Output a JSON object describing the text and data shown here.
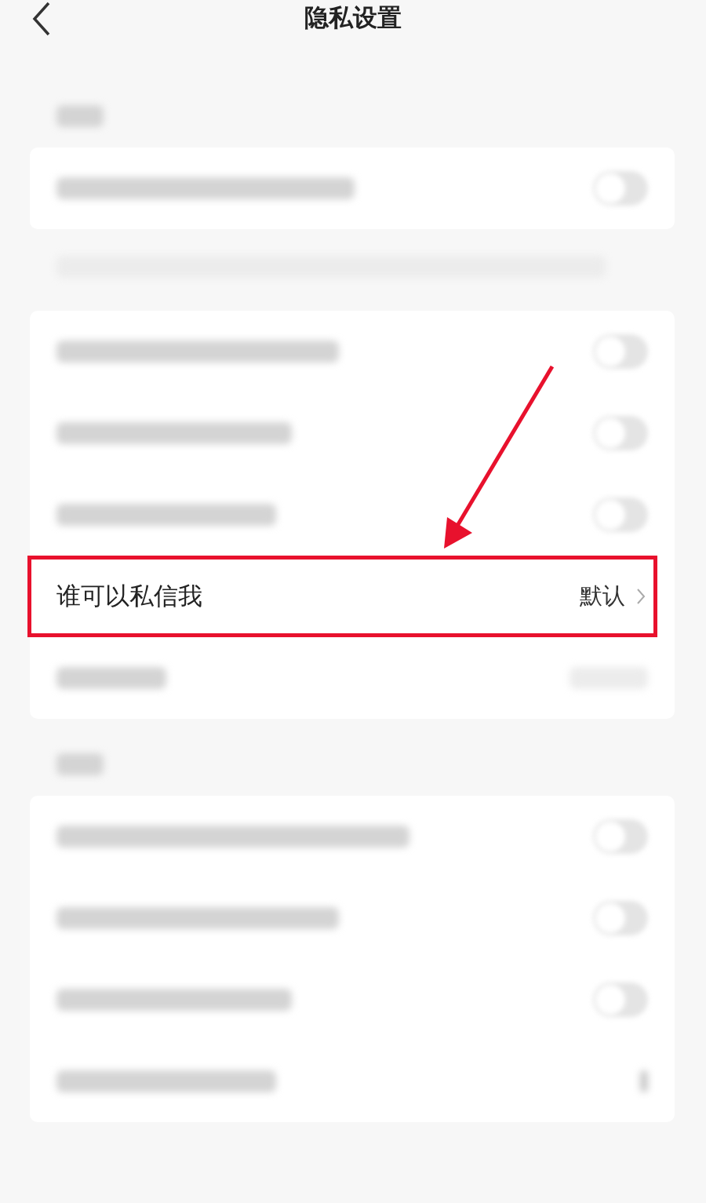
{
  "header": {
    "title": "隐私设置"
  },
  "sections": [
    {
      "kind": "blurred-heading"
    },
    {
      "kind": "card",
      "rows": [
        {
          "kind": "blurred-toggle",
          "on": false
        }
      ]
    },
    {
      "kind": "blurred-note"
    },
    {
      "kind": "card",
      "rows": [
        {
          "kind": "blurred-toggle",
          "on": false
        },
        {
          "kind": "blurred-toggle",
          "on": false
        },
        {
          "kind": "blurred-toggle",
          "on": false
        },
        {
          "kind": "link",
          "label": "谁可以私信我",
          "value": "默认",
          "highlighted": true
        },
        {
          "kind": "blurred-value"
        }
      ]
    },
    {
      "kind": "blurred-heading"
    },
    {
      "kind": "card",
      "rows": [
        {
          "kind": "blurred-toggle",
          "on": false
        },
        {
          "kind": "blurred-toggle",
          "on": false
        },
        {
          "kind": "blurred-toggle",
          "on": false
        },
        {
          "kind": "blurred-link"
        }
      ]
    }
  ]
}
